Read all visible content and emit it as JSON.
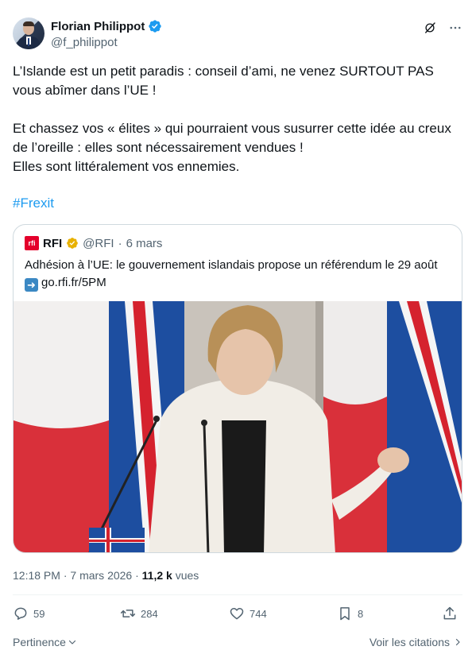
{
  "author": {
    "name": "Florian Philippot",
    "handle": "@f_philippot"
  },
  "tweet": {
    "paragraph1": "L’Islande est un petit paradis : conseil d’ami, ne venez SURTOUT PAS vous abîmer dans l’UE !",
    "paragraph2_line1": "Et chassez vos « élites » qui pourraient vous susurrer cette idée au creux de l’oreille : elles sont nécessairement vendues !",
    "paragraph2_line2": "Elles sont littéralement vos ennemies.",
    "hashtag": "#Frexit"
  },
  "quote": {
    "logo_text": "rfi",
    "name": "RFI",
    "handle": "@RFI",
    "date": "6 mars",
    "separator": "·",
    "text": "Adhésion à l’UE: le gouvernement islandais propose un référendum le 29 août",
    "link": "go.rfi.fr/5PM"
  },
  "meta": {
    "time": "12:18 PM",
    "separator": "·",
    "date": "7 mars 2026",
    "separator2": "·",
    "views_count": "11,2 k",
    "views_label": "vues"
  },
  "actions": {
    "replies": "59",
    "reposts": "284",
    "likes": "744",
    "bookmarks": "8"
  },
  "footer": {
    "left": "Pertinence",
    "right": "Voir les citations"
  },
  "colors": {
    "accent": "#1d9bf0",
    "muted": "#536471",
    "text": "#0f1419",
    "border": "#cfd9de",
    "rfi_red": "#e4002b",
    "verified_gold": "#e8b100"
  },
  "icons": [
    "verified-badge-icon",
    "grok-icon",
    "more-icon",
    "reply-icon",
    "repost-icon",
    "like-icon",
    "bookmark-icon",
    "share-icon",
    "chevron-down-icon",
    "chevron-right-icon",
    "arrow-right-emoji-icon"
  ]
}
